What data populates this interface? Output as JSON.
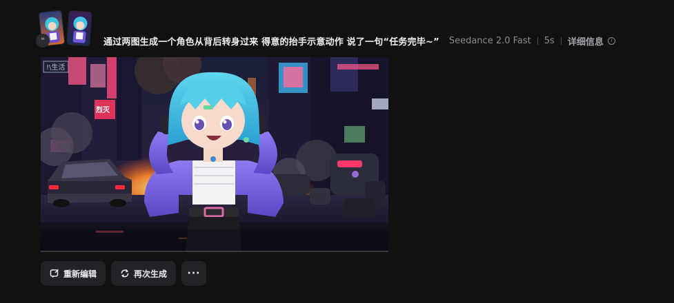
{
  "header": {
    "thumbnails": [
      "reference-image-1",
      "reference-image-2"
    ],
    "quote_icon": "quote-icon",
    "prompt": "通过两图生成一个角色从背后转身过来 得意的抬手示意动作 说了一句“任务完毕~”",
    "model": "Seedance 2.0 Fast",
    "duration": "5s",
    "detail_label": "详细信息",
    "info_icon": "ⓘ"
  },
  "video": {
    "sign_text": "!\\生活",
    "sign_text_2": "烈灭"
  },
  "actions": {
    "reedit_label": "重新编辑",
    "regenerate_label": "再次生成",
    "more_label": "···"
  }
}
